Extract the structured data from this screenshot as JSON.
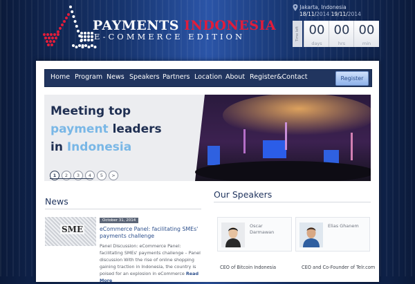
{
  "header": {
    "brand_part1": "PAYMENTS ",
    "brand_part2": "INDONESIA",
    "brand_subtitle": "E-COMMERCE EDITION",
    "location": "Jakarta, Indonesia",
    "date_start_day": "18/11/",
    "date_start_year": "2014",
    "date_end_day": " 19/11/",
    "date_end_year": "2014",
    "countdown_label": "Time left",
    "countdown": [
      {
        "value": "00",
        "unit": "days"
      },
      {
        "value": "00",
        "unit": "hrs"
      },
      {
        "value": "00",
        "unit": "min"
      }
    ],
    "colors": {
      "brand_red": "#e21c3a",
      "navy": "#21355f"
    }
  },
  "nav": {
    "items": [
      "Home",
      "Program",
      "News",
      "Speakers",
      "Partners",
      "Location",
      "About",
      "Register&Contact"
    ],
    "register_button": "Register"
  },
  "hero": {
    "line1": "Meeting top",
    "line2_highlight": "payment",
    "line2_rest": " leaders",
    "line3_prefix": "in ",
    "line3_highlight": "Indonesia",
    "slider_pages": [
      "1",
      "2",
      "3",
      "4",
      "5",
      ">"
    ],
    "active_page": 1
  },
  "news": {
    "title": "News",
    "thumb_text": "SME",
    "date": "October 31, 2014",
    "headline": "eCommerce Panel: facilitating SMEs' payments challenge",
    "body": "Panel Discussion: eCommerce Panel: facilitating SMEs' payments challenge – Panel discussion With the rise of online shopping gaining traction in Indonesia, the country is poised for an explosion in eCommerce",
    "read_more": "Read More"
  },
  "speakers": {
    "title": "Our Speakers",
    "items": [
      {
        "first": "Oscar",
        "last": "Darmawan",
        "role": "CEO of Bitcoin Indonesia"
      },
      {
        "first": "Elias Ghanem",
        "last": "",
        "role": "CEO and Co-Founder of Telr.com"
      }
    ]
  }
}
